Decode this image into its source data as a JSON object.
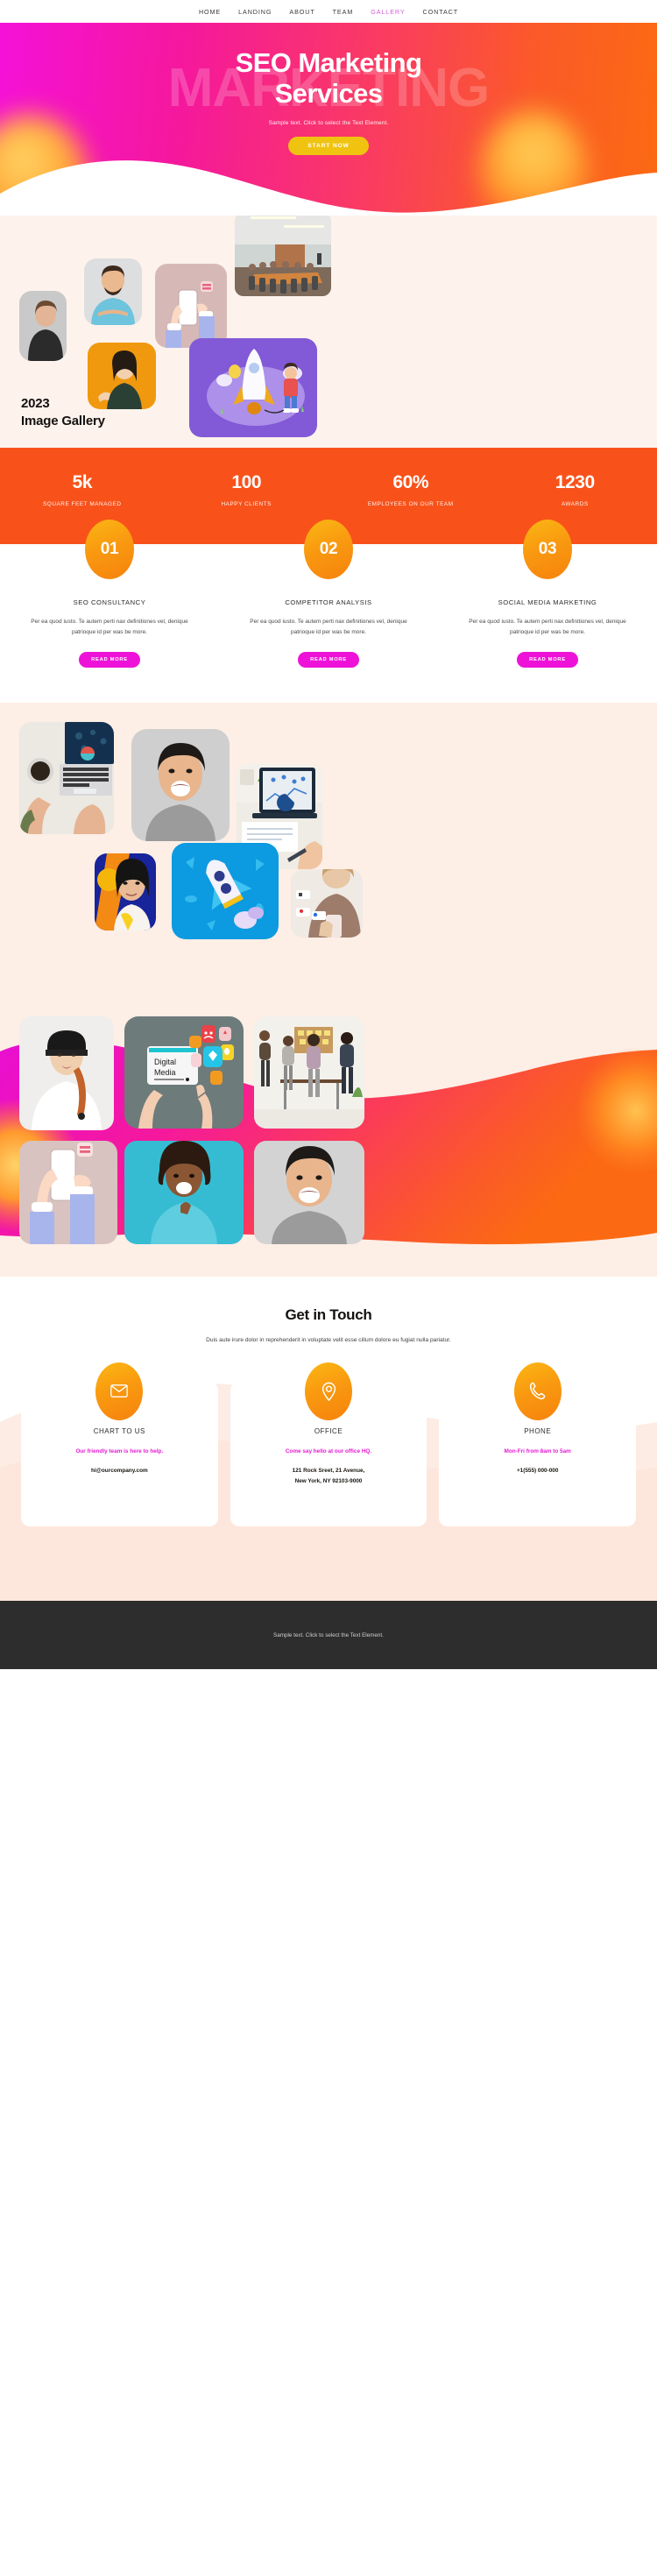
{
  "nav": {
    "items": [
      {
        "label": "HOME",
        "active": false
      },
      {
        "label": "LANDING",
        "active": false
      },
      {
        "label": "ABOUT",
        "active": false
      },
      {
        "label": "TEAM",
        "active": false
      },
      {
        "label": "GALLERY",
        "active": true
      },
      {
        "label": "CONTACT",
        "active": false
      }
    ],
    "active_color": "#cf5fd4"
  },
  "hero": {
    "ghost_word": "MARKETING",
    "title_line1": "SEO Marketing",
    "title_line2": "Services",
    "subtitle": "Sample text. Click to select the Text Element.",
    "cta_label": "START NOW",
    "cta_color": "#f0c310",
    "gradient_from": "#f511d8",
    "gradient_to": "#fb6a12"
  },
  "gallery1": {
    "caption_year": "2023",
    "caption_title": "Image Gallery",
    "items": [
      {
        "name": "portrait-man-black-shirt"
      },
      {
        "name": "portrait-bearded-man-blue-polo"
      },
      {
        "name": "illustration-hand-holding-phone"
      },
      {
        "name": "photo-conference-room-meeting"
      },
      {
        "name": "portrait-woman-orange-background"
      },
      {
        "name": "illustration-rocket-launch-purple"
      }
    ]
  },
  "stats": {
    "background": "#f8521a",
    "items": [
      {
        "value": "5k",
        "label": "SQUARE FEET MANAGED"
      },
      {
        "value": "100",
        "label": "HAPPY CLIENTS"
      },
      {
        "value": "60%",
        "label": "EMPLOYEES ON OUR TEAM"
      },
      {
        "value": "1230",
        "label": "AWARDS"
      }
    ]
  },
  "services": {
    "button_label": "READ MORE",
    "button_color": "#ee12d8",
    "items": [
      {
        "number": "01",
        "title": "SEO CONSULTANCY",
        "body": "Per ea quod iusto. Te autem perti nax definitiones vel, denique patrioque id per was be more."
      },
      {
        "number": "02",
        "title": "COMPETITOR ANALYSIS",
        "body": "Per ea quod iusto. Te autem perti nax definitiones vel, denique patrioque id per was be more."
      },
      {
        "number": "03",
        "title": "SOCIAL MEDIA MARKETING",
        "body": "Per ea quod iusto. Te autem perti nax definitiones vel, denique patrioque id per was be more."
      }
    ]
  },
  "gallery2": {
    "items": [
      {
        "name": "photo-laptop-analytics-coffee"
      },
      {
        "name": "portrait-man-laughing-grey"
      },
      {
        "name": "photo-laptop-dashboard-charts"
      },
      {
        "name": "portrait-woman-blue-orange-art"
      },
      {
        "name": "illustration-rocket-blue"
      },
      {
        "name": "photo-woman-phone-social-likes"
      }
    ]
  },
  "gallery3": {
    "items": [
      {
        "name": "portrait-woman-beanie-braid"
      },
      {
        "name": "photo-tablet-digital-media"
      },
      {
        "name": "photo-team-whiteboard-office"
      },
      {
        "name": "illustration-hand-holding-phone"
      },
      {
        "name": "portrait-woman-blue-turtleneck"
      },
      {
        "name": "portrait-man-laughing-grey"
      }
    ]
  },
  "contact": {
    "title": "Get in Touch",
    "description": "Duis aute irure dolor in reprehenderit in voluptate velit esse cillum dolore eu fugiat nulla pariatur.",
    "cards": [
      {
        "icon": "envelope-icon",
        "title": "CHART TO US",
        "pink": "Our friendly team is here to help.",
        "dark": "hi@ourcompany.com"
      },
      {
        "icon": "map-pin-icon",
        "title": "OFFICE",
        "pink": "Come say hello at our office HQ.",
        "dark": "121 Rock Sreet, 21 Avenue,\nNew York, NY 92103-9000"
      },
      {
        "icon": "phone-icon",
        "title": "PHONE",
        "pink": "Mon-Fri from 8am to 5am",
        "dark": "+1(555) 000-000"
      }
    ]
  },
  "footer": {
    "text": "Sample text. Click to select the Text Element.",
    "background": "#2d2d2d"
  }
}
